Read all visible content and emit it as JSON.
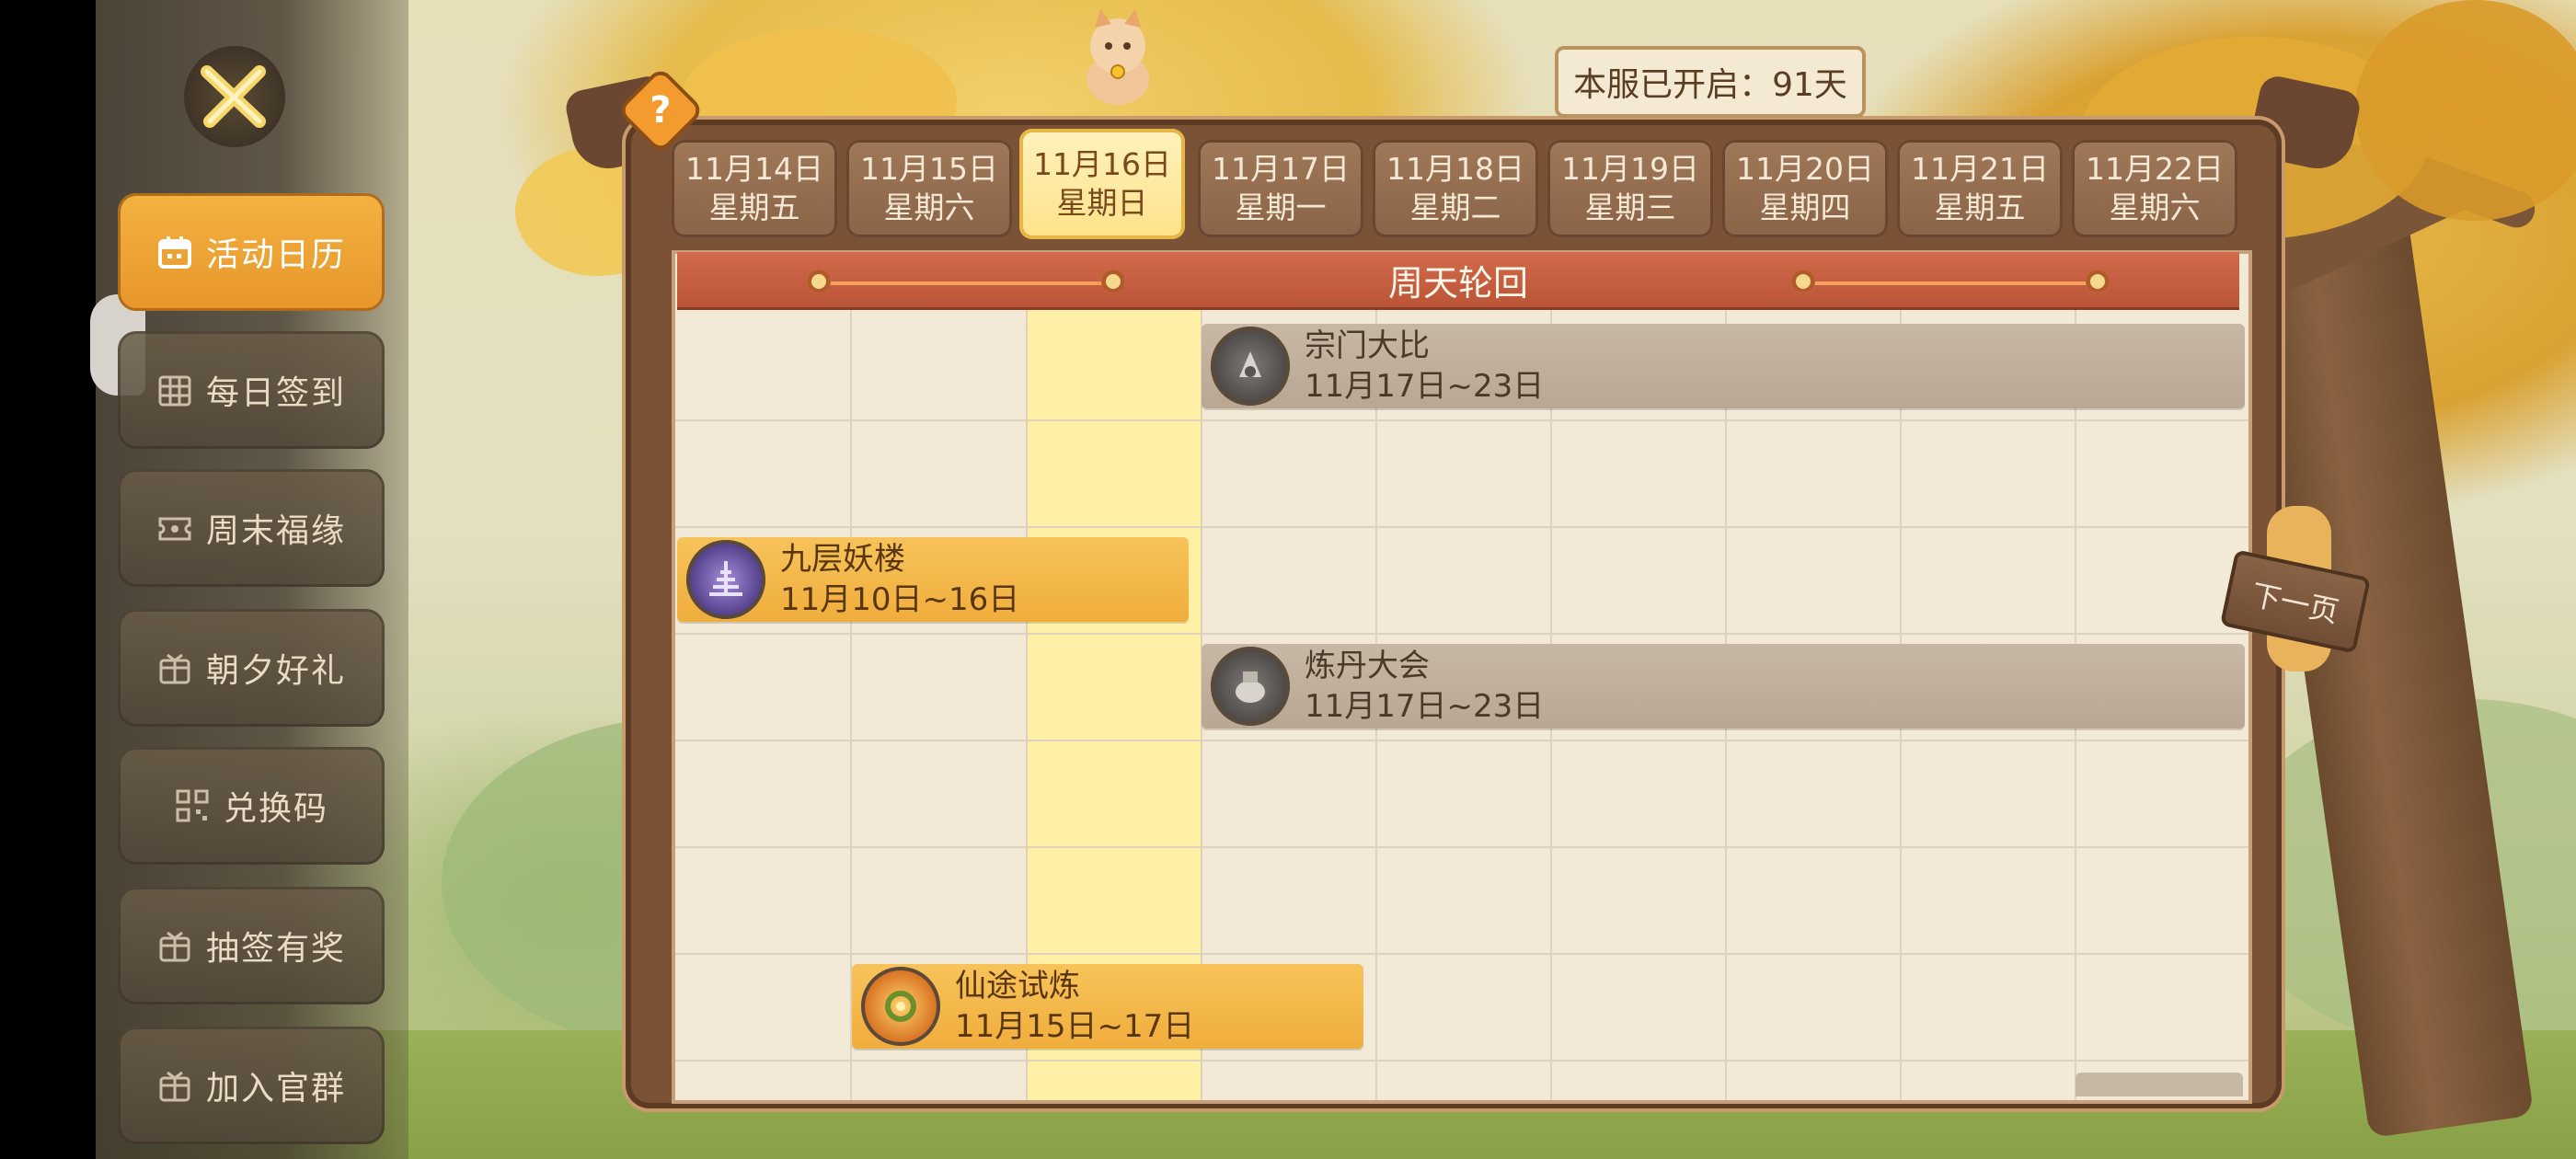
{
  "app": {
    "server_days": "本服已开启：91天",
    "next_page_label": "下一页",
    "help_symbol": "?"
  },
  "sidebar": {
    "items": [
      {
        "label": "活动日历",
        "icon": "calendar-icon",
        "active": true
      },
      {
        "label": "每日签到",
        "icon": "grid-icon",
        "active": false
      },
      {
        "label": "周末福缘",
        "icon": "ticket-icon",
        "active": false
      },
      {
        "label": "朝夕好礼",
        "icon": "gift-box-icon",
        "active": false
      },
      {
        "label": "兑换码",
        "icon": "qr-code-icon",
        "active": false
      },
      {
        "label": "抽签有奖",
        "icon": "gift-box-icon",
        "active": false
      },
      {
        "label": "加入官群",
        "icon": "gift-box-icon",
        "active": false
      }
    ]
  },
  "calendar": {
    "dates": [
      {
        "date": "11月14日",
        "weekday": "星期五",
        "today": false
      },
      {
        "date": "11月15日",
        "weekday": "星期六",
        "today": false
      },
      {
        "date": "11月16日",
        "weekday": "星期日",
        "today": true
      },
      {
        "date": "11月17日",
        "weekday": "星期一",
        "today": false
      },
      {
        "date": "11月18日",
        "weekday": "星期二",
        "today": false
      },
      {
        "date": "11月19日",
        "weekday": "星期三",
        "today": false
      },
      {
        "date": "11月20日",
        "weekday": "星期四",
        "today": false
      },
      {
        "date": "11月21日",
        "weekday": "星期五",
        "today": false
      },
      {
        "date": "11月22日",
        "weekday": "星期六",
        "today": false
      }
    ],
    "section_title": "周天轮回",
    "events": [
      {
        "name": "宗门大比",
        "range": "11月17日~23日",
        "style": "gray"
      },
      {
        "name": "九层妖楼",
        "range": "11月10日~16日",
        "style": "gold"
      },
      {
        "name": "炼丹大会",
        "range": "11月17日~23日",
        "style": "gray"
      },
      {
        "name": "仙途试炼",
        "range": "11月15日~17日",
        "style": "gold"
      }
    ]
  },
  "colors": {
    "active_tab": "#f3b241",
    "today_column": "#fff0a6",
    "header_red": "#c75d40",
    "event_gold": "#f0ad3c",
    "event_gray": "#b9a793"
  }
}
